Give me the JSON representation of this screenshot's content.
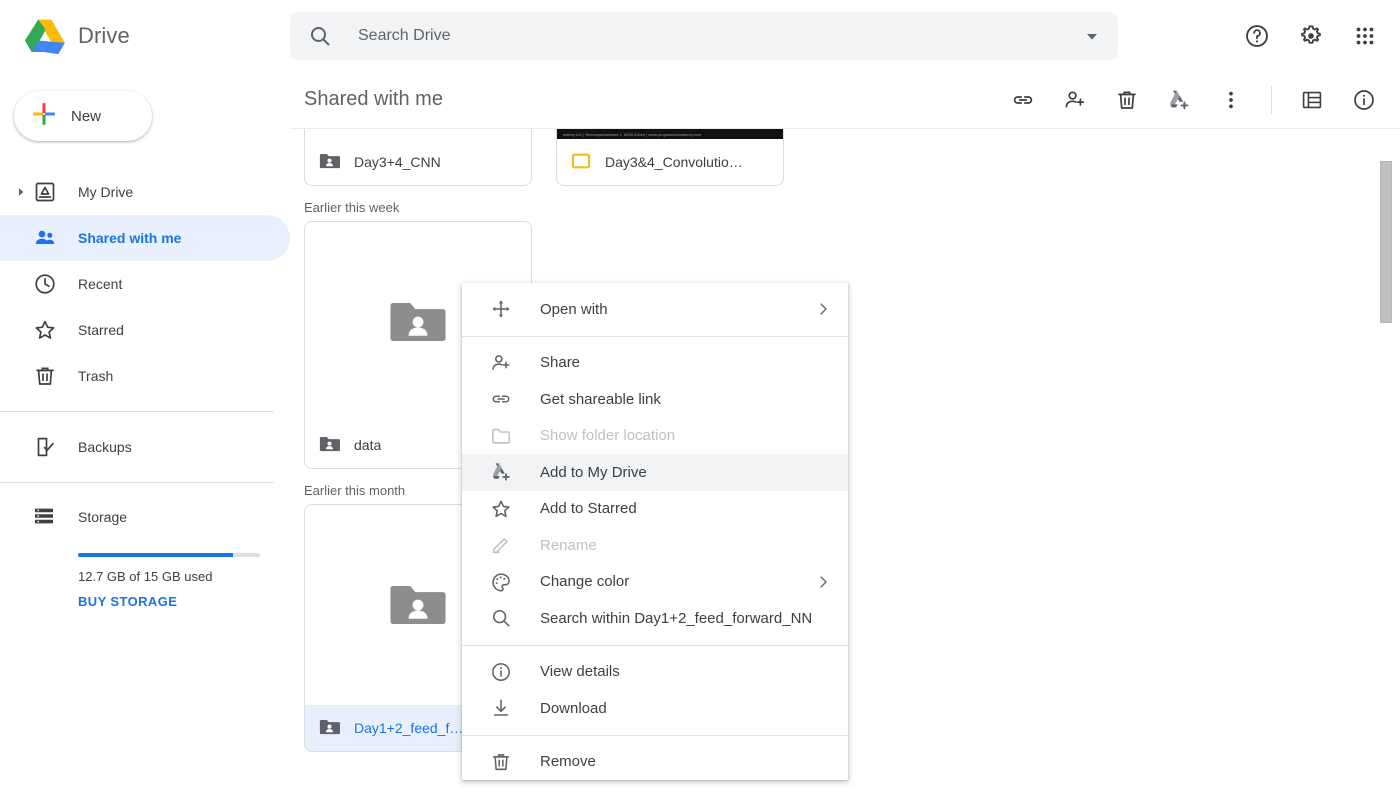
{
  "app": {
    "brand_name": "Drive",
    "logo": "google-drive-logo"
  },
  "search": {
    "placeholder": "Search Drive",
    "value": "",
    "icon": "search-icon",
    "caret_icon": "chevron-down-icon"
  },
  "topbar_icons": [
    {
      "name": "help-icon",
      "label": "Help"
    },
    {
      "name": "settings-gear-icon",
      "label": "Settings"
    },
    {
      "name": "google-apps-grid-icon",
      "label": "Google apps"
    }
  ],
  "sidebar": {
    "new_button": {
      "label": "New",
      "icon": "plus-icon"
    },
    "items": [
      {
        "name": "sidebar-item-my-drive",
        "label": "My Drive",
        "icon": "my-drive-icon",
        "active": false,
        "has_twisty": true
      },
      {
        "name": "sidebar-item-shared-with-me",
        "label": "Shared with me",
        "icon": "people-icon",
        "active": true,
        "has_twisty": false
      },
      {
        "name": "sidebar-item-recent",
        "label": "Recent",
        "icon": "clock-icon",
        "active": false,
        "has_twisty": false
      },
      {
        "name": "sidebar-item-starred",
        "label": "Starred",
        "icon": "star-icon",
        "active": false,
        "has_twisty": false
      },
      {
        "name": "sidebar-item-trash",
        "label": "Trash",
        "icon": "trash-icon",
        "active": false,
        "has_twisty": false
      }
    ],
    "backups": {
      "label": "Backups",
      "icon": "backups-icon"
    },
    "storage": {
      "label": "Storage",
      "icon": "storage-icon",
      "used_text": "12.7 GB of 15 GB used",
      "percent": 85,
      "buy_label": "BUY STORAGE",
      "bar_color": "#1a73e8"
    }
  },
  "main": {
    "title": "Shared with me",
    "actions": [
      {
        "name": "get-link-icon",
        "label": "Get shareable link"
      },
      {
        "name": "add-person-icon",
        "label": "Share"
      },
      {
        "name": "trash-icon",
        "label": "Remove"
      },
      {
        "name": "add-to-drive-icon",
        "label": "Add to My Drive"
      },
      {
        "name": "more-vertical-icon",
        "label": "More actions"
      },
      {
        "name": "list-view-icon",
        "label": "List view"
      },
      {
        "name": "details-info-icon",
        "label": "View details"
      }
    ],
    "sections": [
      {
        "label": "",
        "cards": [
          {
            "name": "Day3+4_CNN",
            "type": "folder-shared",
            "thumb": "folder",
            "selected": false
          },
          {
            "name": "Day3&4_Convolutio…",
            "type": "slides",
            "thumb": "photo",
            "selected": false
          }
        ]
      },
      {
        "label": "Earlier this week",
        "cards": [
          {
            "name": "data",
            "type": "folder-shared",
            "thumb": "folder",
            "selected": false
          }
        ]
      },
      {
        "label": "Earlier this month",
        "cards": [
          {
            "name": "Day1+2_feed_f…",
            "type": "folder-shared",
            "thumb": "folder",
            "selected": true
          }
        ]
      }
    ]
  },
  "context_menu": {
    "groups": [
      [
        {
          "name": "menu-open-with",
          "label": "Open with",
          "icon": "move-arrows-icon",
          "submenu": true,
          "disabled": false,
          "hovered": false
        }
      ],
      [
        {
          "name": "menu-share",
          "label": "Share",
          "icon": "add-person-icon",
          "submenu": false,
          "disabled": false,
          "hovered": false
        },
        {
          "name": "menu-get-shareable-link",
          "label": "Get shareable link",
          "icon": "link-icon",
          "submenu": false,
          "disabled": false,
          "hovered": false
        },
        {
          "name": "menu-show-folder-location",
          "label": "Show folder location",
          "icon": "folder-icon",
          "submenu": false,
          "disabled": true,
          "hovered": false
        },
        {
          "name": "menu-add-to-my-drive",
          "label": "Add to My Drive",
          "icon": "add-to-drive-icon",
          "submenu": false,
          "disabled": false,
          "hovered": true
        },
        {
          "name": "menu-add-to-starred",
          "label": "Add to Starred",
          "icon": "star-icon",
          "submenu": false,
          "disabled": false,
          "hovered": false
        },
        {
          "name": "menu-rename",
          "label": "Rename",
          "icon": "pencil-icon",
          "submenu": false,
          "disabled": true,
          "hovered": false
        },
        {
          "name": "menu-change-color",
          "label": "Change color",
          "icon": "palette-icon",
          "submenu": true,
          "disabled": false,
          "hovered": false
        },
        {
          "name": "menu-search-within",
          "label": "Search within Day1+2_feed_forward_NN",
          "icon": "search-icon",
          "submenu": false,
          "disabled": false,
          "hovered": false
        }
      ],
      [
        {
          "name": "menu-view-details",
          "label": "View details",
          "icon": "info-icon",
          "submenu": false,
          "disabled": false,
          "hovered": false
        },
        {
          "name": "menu-download",
          "label": "Download",
          "icon": "download-icon",
          "submenu": false,
          "disabled": false,
          "hovered": false
        }
      ],
      [
        {
          "name": "menu-remove",
          "label": "Remove",
          "icon": "trash-icon",
          "submenu": false,
          "disabled": false,
          "hovered": false
        }
      ]
    ]
  },
  "colors": {
    "accent": "#1a73e8",
    "accent_bg": "#e8f0fe",
    "text": "#3c4043",
    "muted": "#5f6368",
    "disabled": "#bdc1c6",
    "slides_yellow": "#f5ba15",
    "folder_gray": "#757575"
  }
}
